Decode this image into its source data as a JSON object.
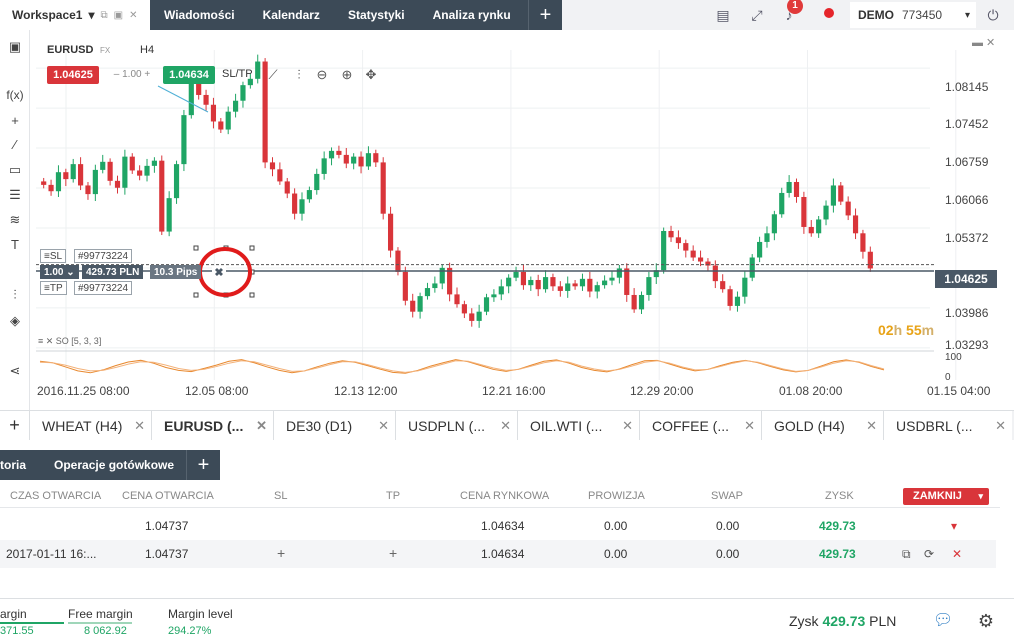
{
  "topbar": {
    "workspace": "Workspace1",
    "workspace_caret": "▾",
    "menu": [
      "Wiadomości",
      "Kalendarz",
      "Statystyki",
      "Analiza rynku"
    ],
    "plus": "+",
    "notification_count": "1",
    "account_type": "DEMO",
    "account_number": "773450",
    "account_caret": "▾"
  },
  "chart": {
    "symbol": "EURUSD",
    "symbol_tag": "FX",
    "timeframe": "H4",
    "sell_price": "1.04625",
    "quantity": "– 1.00 +",
    "buy_price": "1.04634",
    "sltp_label": "SL/TP",
    "current_price": "1.04625",
    "timer": {
      "hours": "02",
      "h": "h",
      "minutes": "55",
      "m": "m"
    },
    "order": {
      "sl_label": "≡SL",
      "sl_id": "#99773224",
      "tp_label": "≡TP",
      "tp_id": "#99773224",
      "volume": "1.00 ⌄",
      "profit": "429.73 PLN",
      "pips": "10.3 Pips",
      "close": "✖"
    },
    "oscillator_label": "≡ ✕ SO [5, 3, 3]",
    "oscillator_axis": [
      "100",
      "0"
    ],
    "colors": {
      "bull": "#1fa565",
      "bear": "#d9353a",
      "oscillator": "#e8892f"
    }
  },
  "chart_data": {
    "type": "candlestick",
    "y_ticks": [
      1.08145,
      1.07452,
      1.06759,
      1.06066,
      1.05372,
      1.04679,
      1.03986,
      1.03293
    ],
    "x_ticks": [
      "2016.11.25 08:00",
      "12.05 08:00",
      "12.13 12:00",
      "12.21 16:00",
      "12.29 20:00",
      "01.08 20:00",
      "01.15 04:00"
    ],
    "ylim": [
      1.0329,
      1.0846
    ],
    "current_price": 1.04625,
    "open_price": 1.04737,
    "grid": true,
    "close_series": [
      1.0612,
      1.0601,
      1.0634,
      1.0622,
      1.0648,
      1.0611,
      1.0596,
      1.0638,
      1.0652,
      1.0619,
      1.0607,
      1.0661,
      1.0637,
      1.0628,
      1.0645,
      1.0654,
      1.0531,
      1.0589,
      1.0648,
      1.0733,
      1.0792,
      1.0768,
      1.0751,
      1.0722,
      1.0708,
      1.0739,
      1.0758,
      1.0785,
      1.0796,
      1.0826,
      1.0651,
      1.0639,
      1.0618,
      1.0597,
      1.0562,
      1.0587,
      1.0603,
      1.0631,
      1.0658,
      1.0671,
      1.0664,
      1.0649,
      1.0661,
      1.0644,
      1.0667,
      1.0651,
      1.0562,
      1.0498,
      1.0461,
      1.0411,
      1.0392,
      1.0419,
      1.0433,
      1.0441,
      1.0468,
      1.0422,
      1.0405,
      1.0389,
      1.0376,
      1.0392,
      1.0417,
      1.0422,
      1.0436,
      1.0451,
      1.0461,
      1.0438,
      1.0447,
      1.0431,
      1.0452,
      1.0436,
      1.0428,
      1.0441,
      1.0436,
      1.0449,
      1.0427,
      1.0438,
      1.0446,
      1.0451,
      1.0467,
      1.0421,
      1.0396,
      1.0421,
      1.0452,
      1.0464,
      1.0532,
      1.0521,
      1.0511,
      1.0498,
      1.0486,
      1.0479,
      1.0472,
      1.0445,
      1.0431,
      1.0402,
      1.0418,
      1.0451,
      1.0486,
      1.0513,
      1.0528,
      1.0561,
      1.0598,
      1.0617,
      1.0591,
      1.0539,
      1.0528,
      1.0552,
      1.0576,
      1.0611,
      1.0583,
      1.0559,
      1.0528,
      1.0496,
      1.0467
    ],
    "oscillator_k": [
      78,
      72,
      55,
      38,
      30,
      42,
      60,
      75,
      82,
      70,
      52,
      40,
      35,
      48,
      62,
      78,
      85,
      72,
      55,
      40,
      30,
      38,
      55,
      70,
      80,
      74,
      60,
      45,
      32,
      28,
      40,
      58,
      72,
      85,
      76,
      60,
      44,
      36,
      45,
      62,
      78,
      84,
      70,
      52,
      40,
      34,
      46,
      64,
      80,
      82,
      66,
      50,
      38,
      44,
      60,
      74,
      82,
      72,
      56,
      42,
      34,
      40,
      58,
      76,
      84,
      74,
      56,
      42
    ],
    "oscillator_d": [
      74,
      72,
      62,
      48,
      38,
      40,
      52,
      66,
      76,
      74,
      62,
      48,
      40,
      44,
      56,
      70,
      80,
      76,
      62,
      48,
      36,
      38,
      50,
      64,
      76,
      76,
      64,
      50,
      38,
      32,
      38,
      52,
      66,
      80,
      78,
      64,
      50,
      40,
      44,
      58,
      72,
      80,
      74,
      58,
      46,
      38,
      44,
      58,
      74,
      80,
      70,
      54,
      42,
      44,
      56,
      70,
      80,
      74,
      60,
      46,
      36,
      40,
      54,
      70,
      80,
      76,
      60,
      46
    ]
  },
  "instrument_tabs": [
    {
      "label": "WHEAT (H4)",
      "close": "✕"
    },
    {
      "label": "EURUSD (...",
      "close": "✕",
      "active": true
    },
    {
      "label": "DE30 (D1)",
      "close": "✕"
    },
    {
      "label": "USDPLN (...",
      "close": "✕"
    },
    {
      "label": "OIL.WTI (...",
      "close": "✕"
    },
    {
      "label": "COFFEE (...",
      "close": "✕"
    },
    {
      "label": "GOLD (H4)",
      "close": "✕"
    },
    {
      "label": "USDBRL (...",
      "close": "✕"
    }
  ],
  "panel_tabs": {
    "historia": "toria",
    "operacje": "Operacje gotówkowe",
    "plus": "+"
  },
  "positions": {
    "columns": [
      "CZAS OTWARCIA",
      "CENA OTWARCIA",
      "SL",
      "TP",
      "CENA RYNKOWA",
      "PROWIZJA",
      "SWAP",
      "ZYSK"
    ],
    "close_button": "ZAMKNIJ",
    "close_caret": "▾",
    "summary": {
      "open_price": "1.04737",
      "market_price": "1.04634",
      "commission": "0.00",
      "swap": "0.00",
      "profit": "429.73",
      "expand": "▾"
    },
    "rows": [
      {
        "open_time": "2017-01-11 16:...",
        "open_price": "1.04737",
        "sl": "+",
        "tp": "+",
        "market_price": "1.04634",
        "commission": "0.00",
        "swap": "0.00",
        "profit": "429.73",
        "icon_copy": "⧉",
        "icon_refresh": "⟳",
        "icon_close": "✕"
      }
    ]
  },
  "bottom": {
    "margin_label": "argin",
    "margin_value": "371.55",
    "free_margin_label": "Free margin",
    "free_margin_value": "8 062.92",
    "margin_level_label": "Margin level",
    "margin_level_value": "294.27%",
    "zysk_label": "Zysk",
    "zysk_value": "429.73",
    "zysk_currency": "PLN"
  }
}
